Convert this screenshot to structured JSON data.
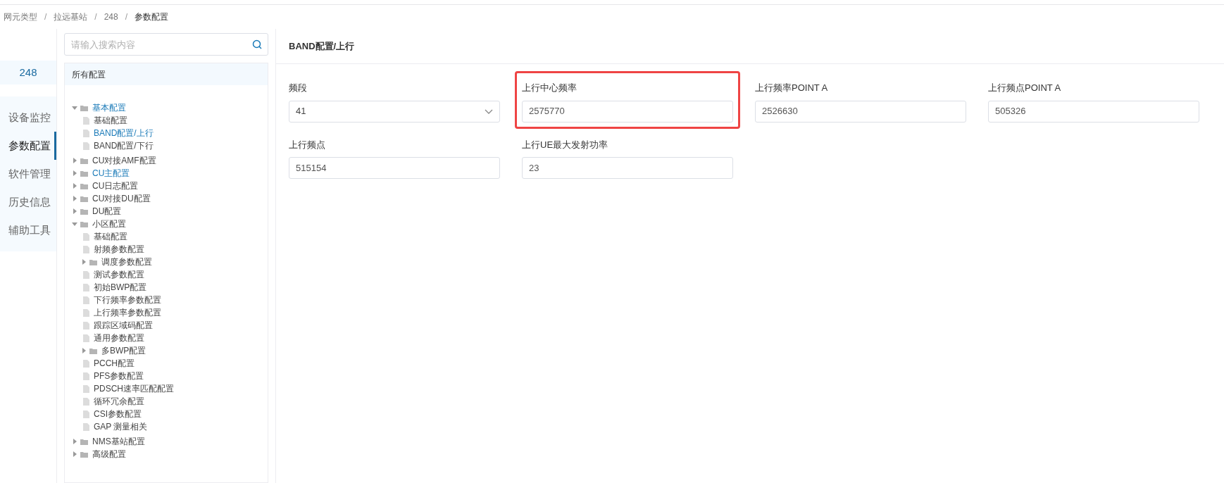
{
  "breadcrumb": [
    {
      "label": "网元类型",
      "separator": "/"
    },
    {
      "label": "拉远基站",
      "separator": "/"
    },
    {
      "label": "248",
      "separator": "/"
    },
    {
      "label": "参数配置"
    }
  ],
  "device": {
    "name": "248"
  },
  "nav": [
    {
      "label": "设备监控",
      "selected": false
    },
    {
      "label": "参数配置",
      "selected": true
    },
    {
      "label": "软件管理",
      "selected": false
    },
    {
      "label": "历史信息",
      "selected": false
    },
    {
      "label": "辅助工具",
      "selected": false
    }
  ],
  "search": {
    "placeholder": "请输入搜索内容"
  },
  "tree": {
    "title": "所有配置",
    "items": [
      {
        "kind": "folder",
        "label": "基本配置",
        "expanded": true,
        "selected": true,
        "children": [
          {
            "kind": "file",
            "label": "基础配置",
            "selected": false
          },
          {
            "kind": "file",
            "label": "BAND配置/上行",
            "selected": true
          },
          {
            "kind": "file",
            "label": "BAND配置/下行",
            "selected": false
          }
        ]
      },
      {
        "kind": "folder",
        "label": "CU对接AMF配置",
        "expanded": false,
        "selected": false
      },
      {
        "kind": "folder",
        "label": "CU主配置",
        "expanded": false,
        "selected": true
      },
      {
        "kind": "folder",
        "label": "CU日志配置",
        "expanded": false,
        "selected": false
      },
      {
        "kind": "folder",
        "label": "CU对接DU配置",
        "expanded": false,
        "selected": false
      },
      {
        "kind": "folder",
        "label": "DU配置",
        "expanded": false,
        "selected": false
      },
      {
        "kind": "folder",
        "label": "小区配置",
        "expanded": true,
        "selected": false,
        "children": [
          {
            "kind": "file",
            "label": "基础配置",
            "selected": false
          },
          {
            "kind": "file",
            "label": "射频参数配置",
            "selected": false
          },
          {
            "kind": "folder",
            "label": "调度参数配置",
            "expanded": false,
            "selected": false
          },
          {
            "kind": "file",
            "label": "测试参数配置",
            "selected": false
          },
          {
            "kind": "file",
            "label": "初始BWP配置",
            "selected": false
          },
          {
            "kind": "file",
            "label": "下行频率参数配置",
            "selected": false
          },
          {
            "kind": "file",
            "label": "上行频率参数配置",
            "selected": false
          },
          {
            "kind": "file",
            "label": "跟踪区域码配置",
            "selected": false
          },
          {
            "kind": "file",
            "label": "通用参数配置",
            "selected": false
          },
          {
            "kind": "folder",
            "label": "多BWP配置",
            "expanded": false,
            "selected": false
          },
          {
            "kind": "file",
            "label": "PCCH配置",
            "selected": false
          },
          {
            "kind": "file",
            "label": "PFS参数配置",
            "selected": false
          },
          {
            "kind": "file",
            "label": "PDSCH速率匹配配置",
            "selected": false
          },
          {
            "kind": "file",
            "label": "循环冗余配置",
            "selected": false
          },
          {
            "kind": "file",
            "label": "CSI参数配置",
            "selected": false
          },
          {
            "kind": "file",
            "label": "GAP 测量相关",
            "selected": false
          }
        ]
      },
      {
        "kind": "folder",
        "label": "NMS基站配置",
        "expanded": false,
        "selected": false
      },
      {
        "kind": "folder",
        "label": "高级配置",
        "expanded": false,
        "selected": false
      }
    ]
  },
  "panel": {
    "title": "BAND配置/上行",
    "fields": [
      {
        "kind": "select",
        "label": "频段",
        "value": "41",
        "highlighted": false
      },
      {
        "kind": "text",
        "label": "上行中心频率",
        "value": "2575770",
        "highlighted": true
      },
      {
        "kind": "text",
        "label": "上行频率POINT A",
        "value": "2526630",
        "highlighted": false
      },
      {
        "kind": "text",
        "label": "上行频点POINT A",
        "value": "505326",
        "highlighted": false
      },
      {
        "kind": "text",
        "label": "上行频点",
        "value": "515154",
        "highlighted": false
      },
      {
        "kind": "text",
        "label": "上行UE最大发射功率",
        "value": "23",
        "highlighted": false
      }
    ]
  }
}
